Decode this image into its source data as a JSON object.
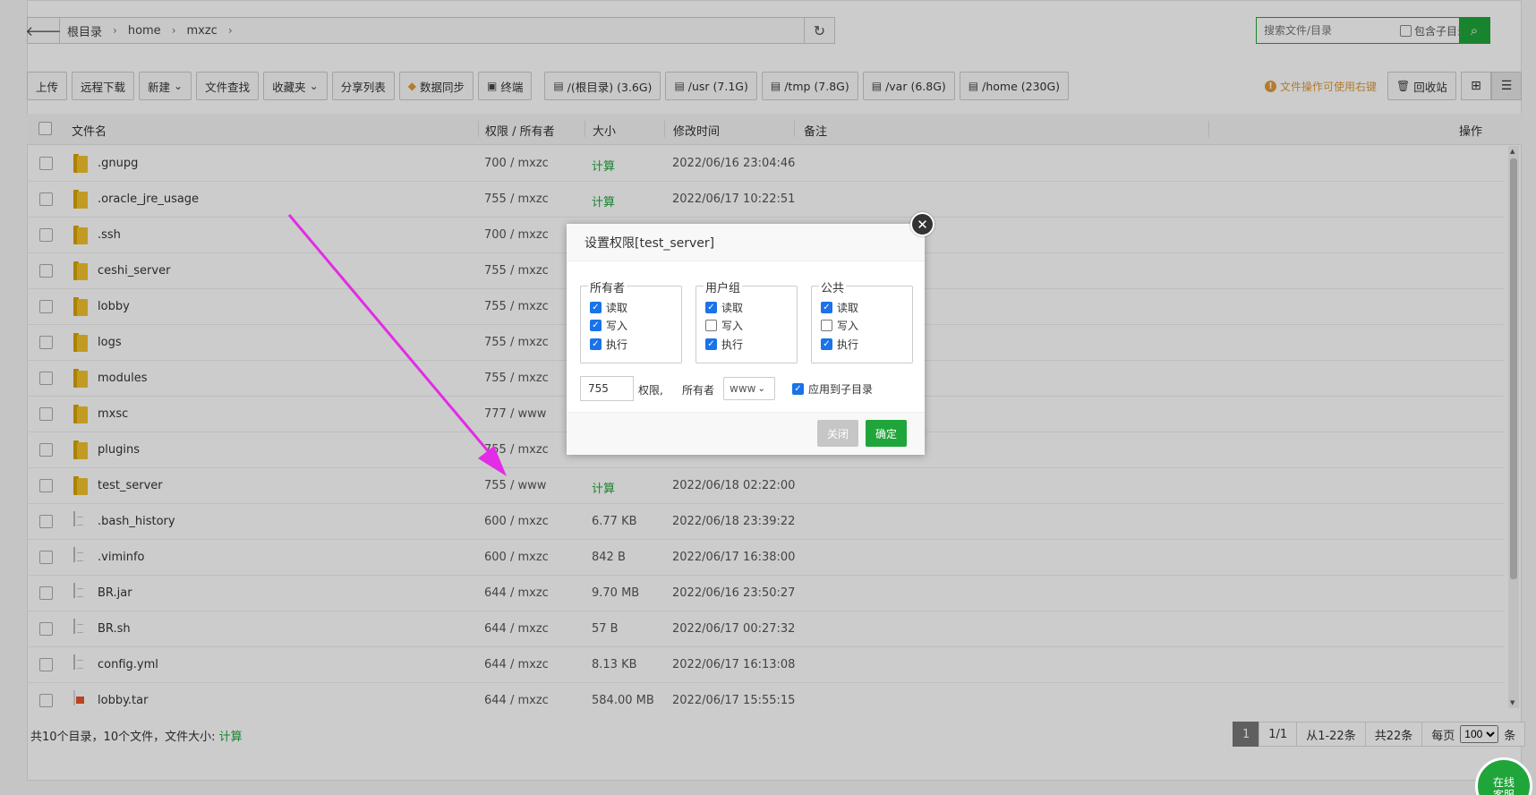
{
  "path": {
    "crumbs": [
      "根目录",
      "home",
      "mxzc"
    ]
  },
  "search": {
    "placeholder": "搜索文件/目录",
    "include_sub_label": "包含子目录"
  },
  "toolbar": {
    "buttons": [
      "上传",
      "远程下载",
      "新建",
      "文件查找",
      "收藏夹",
      "分享列表",
      "数据同步",
      "终端"
    ],
    "disks": [
      "/(根目录) (3.6G)",
      "/usr (7.1G)",
      "/tmp (7.8G)",
      "/var (6.8G)",
      "/home (230G)"
    ],
    "hint": "文件操作可使用右键",
    "recycle_label": "回收站"
  },
  "table": {
    "headers": {
      "name": "文件名",
      "perm": "权限 / 所有者",
      "size": "大小",
      "mtime": "修改时间",
      "note": "备注",
      "ops": "操作"
    },
    "rows": [
      {
        "type": "folder",
        "name": ".gnupg",
        "perm": "700 / mxzc",
        "size": "计算",
        "time": "2022/06/16 23:04:46"
      },
      {
        "type": "folder",
        "name": ".oracle_jre_usage",
        "perm": "755 / mxzc",
        "size": "计算",
        "time": "2022/06/17 10:22:51"
      },
      {
        "type": "folder",
        "name": ".ssh",
        "perm": "700 / mxzc",
        "size": "",
        "time": ""
      },
      {
        "type": "folder",
        "name": "ceshi_server",
        "perm": "755 / mxzc",
        "size": "",
        "time": ""
      },
      {
        "type": "folder",
        "name": "lobby",
        "perm": "755 / mxzc",
        "size": "",
        "time": ""
      },
      {
        "type": "folder",
        "name": "logs",
        "perm": "755 / mxzc",
        "size": "",
        "time": ""
      },
      {
        "type": "folder",
        "name": "modules",
        "perm": "755 / mxzc",
        "size": "",
        "time": ""
      },
      {
        "type": "folder",
        "name": "mxsc",
        "perm": "777 / www",
        "size": "",
        "time": ""
      },
      {
        "type": "folder",
        "name": "plugins",
        "perm": "755 / mxzc",
        "size": "",
        "time": ""
      },
      {
        "type": "folder",
        "name": "test_server",
        "perm": "755 / www",
        "size": "计算",
        "time": "2022/06/18 02:22:00"
      },
      {
        "type": "file",
        "name": ".bash_history",
        "perm": "600 / mxzc",
        "size": "6.77 KB",
        "time": "2022/06/18 23:39:22"
      },
      {
        "type": "file",
        "name": ".viminfo",
        "perm": "600 / mxzc",
        "size": "842 B",
        "time": "2022/06/17 16:38:00"
      },
      {
        "type": "file",
        "name": "BR.jar",
        "perm": "644 / mxzc",
        "size": "9.70 MB",
        "time": "2022/06/16 23:50:27"
      },
      {
        "type": "file",
        "name": "BR.sh",
        "perm": "644 / mxzc",
        "size": "57 B",
        "time": "2022/06/17 00:27:32"
      },
      {
        "type": "file",
        "name": "config.yml",
        "perm": "644 / mxzc",
        "size": "8.13 KB",
        "time": "2022/06/17 16:13:08"
      },
      {
        "type": "tar",
        "name": "lobby.tar",
        "perm": "644 / mxzc",
        "size": "584.00 MB",
        "time": "2022/06/17 15:55:15"
      }
    ]
  },
  "footer": {
    "summary": "共10个目录，10个文件，文件大小:",
    "calc": "计算",
    "pager": {
      "current": "1",
      "pages": "1/1",
      "range": "从1-22条",
      "total": "共22条",
      "per_page_label": "每页",
      "per_page": "100",
      "unit": "条"
    },
    "service": [
      "在线",
      "客服"
    ]
  },
  "dialog": {
    "title": "设置权限[test_server]",
    "groups": [
      {
        "legend": "所有者",
        "items": [
          {
            "label": "读取",
            "checked": true
          },
          {
            "label": "写入",
            "checked": true
          },
          {
            "label": "执行",
            "checked": true
          }
        ]
      },
      {
        "legend": "用户组",
        "items": [
          {
            "label": "读取",
            "checked": true
          },
          {
            "label": "写入",
            "checked": false
          },
          {
            "label": "执行",
            "checked": true
          }
        ]
      },
      {
        "legend": "公共",
        "items": [
          {
            "label": "读取",
            "checked": true
          },
          {
            "label": "写入",
            "checked": false
          },
          {
            "label": "执行",
            "checked": true
          }
        ]
      }
    ],
    "perm_value": "755",
    "perm_label": "权限,",
    "owner_label": "所有者",
    "owner_value": "www",
    "apply_sub_label": "应用到子目录",
    "close_label": "关闭",
    "ok_label": "确定"
  },
  "colors": {
    "accent": "#20a53a",
    "hint": "#e09c3a",
    "arrow": "#e22ce6"
  }
}
